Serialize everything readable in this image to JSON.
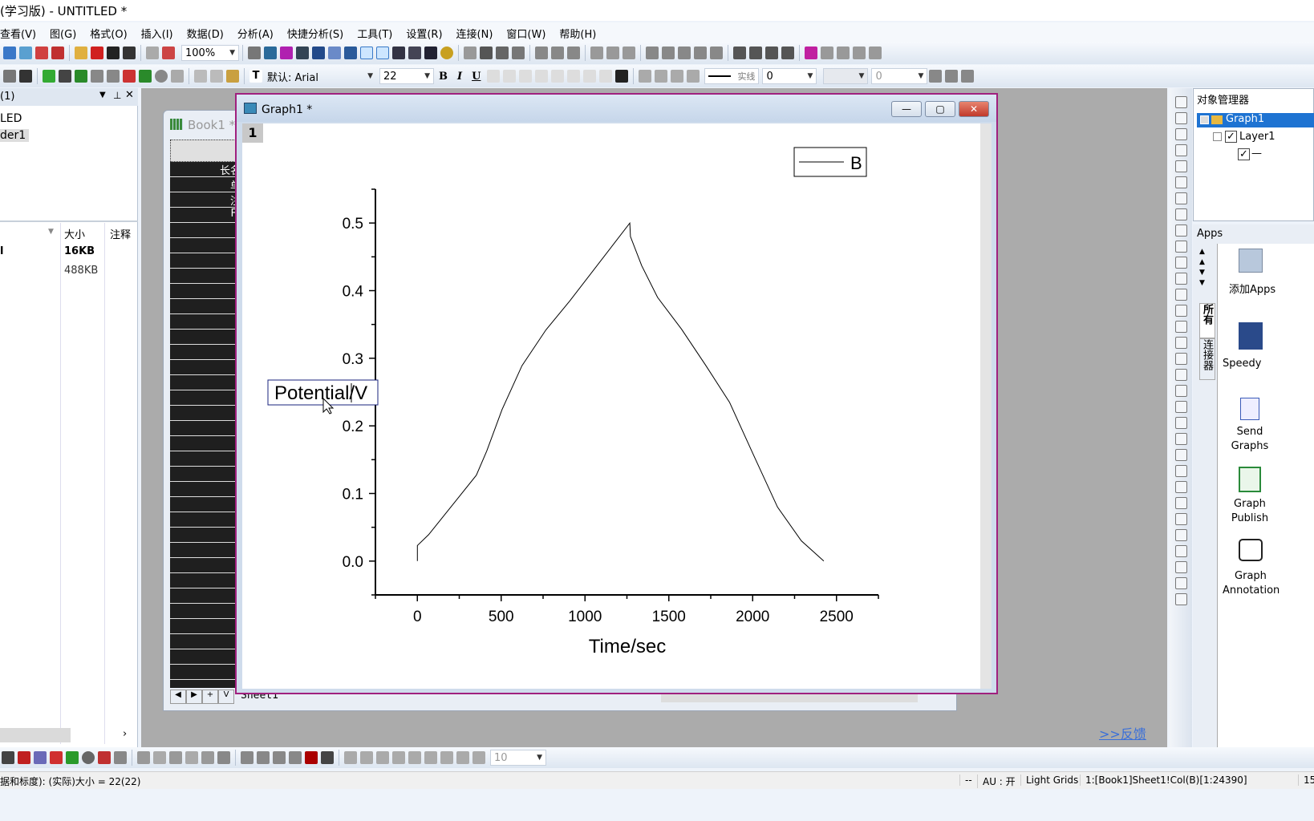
{
  "window": {
    "title": "(学习版) - UNTITLED *"
  },
  "menu": [
    "查看(V)",
    "图(G)",
    "格式(O)",
    "插入(I)",
    "数据(D)",
    "分析(A)",
    "快捷分析(S)",
    "工具(T)",
    "设置(R)",
    "连接(N)",
    "窗口(W)",
    "帮助(H)"
  ],
  "toolbar": {
    "zoom": "100%",
    "font": "默认: Arial",
    "font_size": "22",
    "bold": "B",
    "italic": "I",
    "underline": "U",
    "line_style": "实线",
    "line_width": "0",
    "fill_value": "0",
    "bottom_combo": "10"
  },
  "project_explorer": {
    "header": "(1)",
    "tree": [
      "LED",
      "der1"
    ],
    "list_headers": {
      "size": "大小",
      "comment": "注释"
    },
    "rows": [
      {
        "name": "l",
        "size": "16KB"
      },
      {
        "name": "",
        "size": "488KB"
      }
    ]
  },
  "book_window": {
    "title": "Book1 *",
    "row_labels": [
      "长名",
      "单",
      "注",
      "F("
    ],
    "sheet_tab": "Sheet1"
  },
  "graph_window": {
    "title": "Graph1 *",
    "layer": "1",
    "legend": "B",
    "ylabel_edit": "Potential/V"
  },
  "chart_data": {
    "type": "line",
    "xlabel": "Time/sec",
    "ylabel": "Potential/V",
    "xlim": [
      -250,
      2750
    ],
    "ylim": [
      -0.05,
      0.55
    ],
    "xticks": [
      0,
      500,
      1000,
      1500,
      2000,
      2500
    ],
    "yticks": [
      "0.0",
      "0.1",
      "0.2",
      "0.3",
      "0.4",
      "0.5"
    ],
    "grid": false,
    "legend_position": "top-right",
    "series": [
      {
        "name": "B",
        "color": "#000000",
        "x": [
          0,
          0,
          67,
          229,
          352,
          414,
          505,
          624,
          767,
          910,
          1171,
          1267,
          1271,
          1338,
          1433,
          1576,
          1719,
          1862,
          2005,
          2148,
          2290,
          2424
        ],
        "y": [
          0,
          0.023,
          0.039,
          0.089,
          0.127,
          0.163,
          0.224,
          0.289,
          0.342,
          0.385,
          0.469,
          0.5,
          0.48,
          0.437,
          0.39,
          0.343,
          0.29,
          0.235,
          0.157,
          0.08,
          0.03,
          0.0
        ]
      }
    ]
  },
  "object_manager": {
    "title": "对象管理器",
    "items": [
      "Graph1",
      "Layer1",
      "—"
    ]
  },
  "apps": {
    "title": "Apps",
    "tabs": [
      "所有",
      "连接器"
    ],
    "items": [
      "添加Apps",
      "Speedy",
      "Send Graphs",
      "Graph Publish",
      "Graph Annotation"
    ]
  },
  "feedback_link": ">>反馈",
  "status": {
    "left": "据和标度): (实际)大小 = 22(22)",
    "dash": "--",
    "au": "AU : 开",
    "grids": "Light Grids",
    "ref": "1:[Book1]Sheet1!Col(B)[1:24390]",
    "extra": "15"
  },
  "colors": {
    "graph_border": "#a0207e",
    "mdi_bg": "#ababab",
    "link": "#3a6fd8"
  }
}
